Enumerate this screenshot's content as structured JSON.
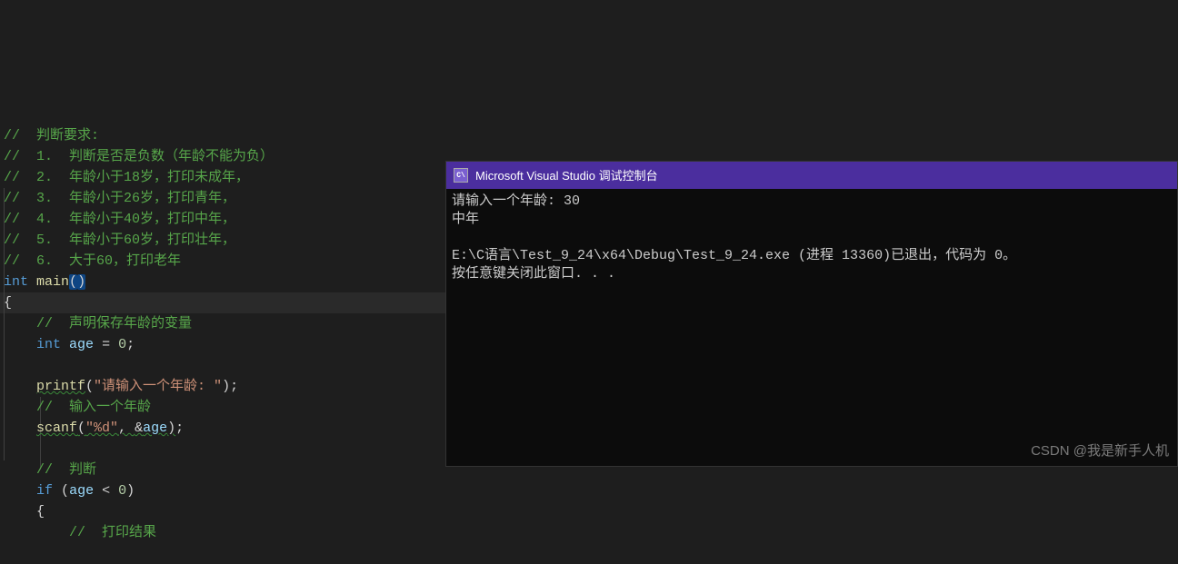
{
  "code": {
    "c1": "//  判断要求:",
    "c2": "//  1.  判断是否是负数（年龄不能为负）",
    "c3": "//  2.  年龄小于18岁，打印未成年，",
    "c4": "//  3.  年龄小于26岁，打印青年，",
    "c5": "//  4.  年龄小于40岁，打印中年，",
    "c6": "//  5.  年龄小于60岁，打印壮年，",
    "c7": "//  6.  大于60，打印老年",
    "kw_int": "int",
    "fn_main": "main",
    "paren_open": "(",
    "paren_close": ")",
    "brace_open": "{",
    "c8": "//  声明保存年龄的变量",
    "var_age_decl": "age",
    "eq": " = ",
    "zero": "0",
    "semi": ";",
    "fn_printf": "printf",
    "str_prompt": "\"请输入一个年龄: \"",
    "c9": "//  输入一个年龄",
    "fn_scanf": "scanf",
    "str_fmt": "\"%d\"",
    "comma": ", ",
    "amp": "&",
    "c10": "//  判断",
    "kw_if": "if",
    "lt": " < ",
    "c11": "//  打印结果"
  },
  "console": {
    "title": "Microsoft Visual Studio 调试控制台",
    "line1": "请输入一个年龄: 30",
    "line2": "中年",
    "line3": "",
    "line4": "E:\\C语言\\Test_9_24\\x64\\Debug\\Test_9_24.exe (进程 13360)已退出，代码为 0。",
    "line5": "按任意键关闭此窗口. . ."
  },
  "watermark": "CSDN @我是新手人机"
}
